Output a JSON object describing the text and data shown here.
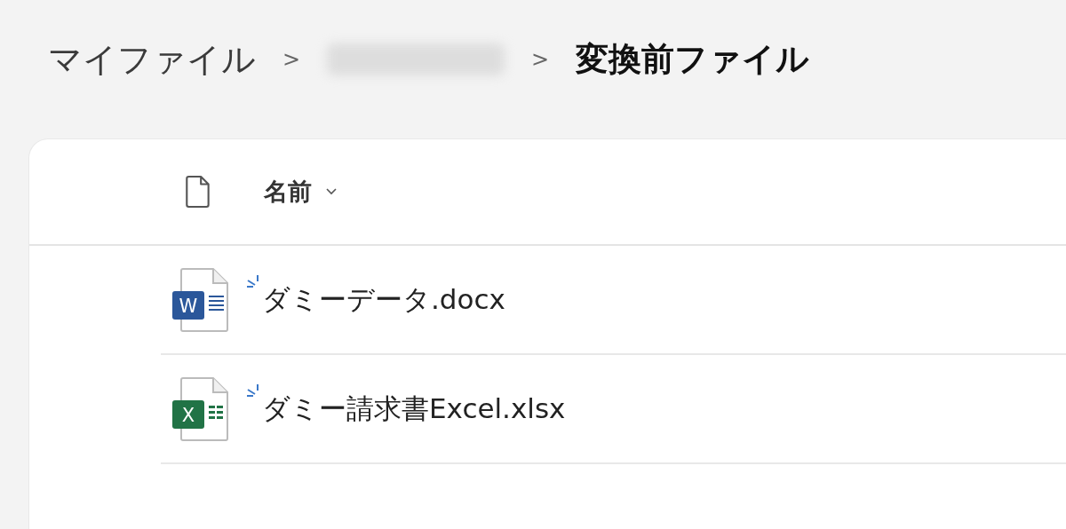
{
  "breadcrumb": [
    {
      "label": "マイファイル",
      "redacted": false,
      "current": false
    },
    {
      "redacted": true,
      "current": false
    },
    {
      "label": "変換前ファイル",
      "redacted": false,
      "current": true
    }
  ],
  "separator": ">",
  "table": {
    "columns": [
      {
        "label": "名前",
        "sorted": true
      }
    ],
    "rows": [
      {
        "name": "ダミーデータ.docx",
        "kind": "word",
        "icon_letter": "W",
        "new": true
      },
      {
        "name": "ダミー請求書Excel.xlsx",
        "kind": "excel",
        "icon_letter": "X",
        "new": true
      }
    ]
  }
}
